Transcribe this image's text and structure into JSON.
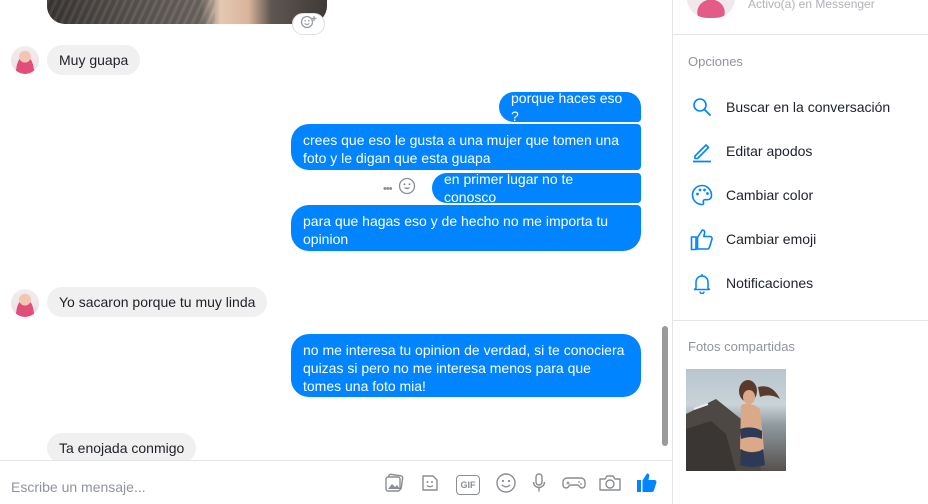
{
  "thread": {
    "messages": [
      {
        "from": "them",
        "text": "Muy guapa"
      },
      {
        "from": "me",
        "text": "porque haces eso ?"
      },
      {
        "from": "me",
        "text": "crees que eso le gusta a una mujer que tomen una foto y le digan que esta guapa"
      },
      {
        "from": "me",
        "text": "en primer lugar no te conosco"
      },
      {
        "from": "me",
        "text": "para que hagas eso y de hecho no me importa tu opinion"
      },
      {
        "from": "them",
        "text": "Yo sacaron porque tu muy linda"
      },
      {
        "from": "me",
        "text": "no me interesa tu opinion de verdad, si te conociera quizas si pero no me interesa menos para que tomes una foto mia!"
      },
      {
        "from": "them",
        "text": "Ta enojada conmigo"
      }
    ],
    "more_label": "•••",
    "icons": {
      "reaction": "add-reaction-icon",
      "more": "more-icon",
      "emoji": "emoji-icon"
    }
  },
  "composer": {
    "placeholder": "Escribe un mensaje...",
    "gif_label": "GIF",
    "tools": [
      "photo-icon",
      "sticker-icon",
      "gif-icon",
      "emoji-icon",
      "microphone-icon",
      "game-icon",
      "camera-icon",
      "like-icon"
    ]
  },
  "panel": {
    "status": "Activo(a) en Messenger",
    "options_title": "Opciones",
    "options": [
      {
        "label": "Buscar en la conversación",
        "icon": "search-icon"
      },
      {
        "label": "Editar apodos",
        "icon": "pencil-icon"
      },
      {
        "label": "Cambiar color",
        "icon": "palette-icon"
      },
      {
        "label": "Cambiar emoji",
        "icon": "like-icon"
      },
      {
        "label": "Notificaciones",
        "icon": "bell-icon"
      }
    ],
    "shared_title": "Fotos compartidas"
  },
  "colors": {
    "accent": "#0084ff",
    "incoming_bubble": "#f1f0f0",
    "outgoing_bubble": "#0084ff",
    "muted": "#90949c"
  }
}
